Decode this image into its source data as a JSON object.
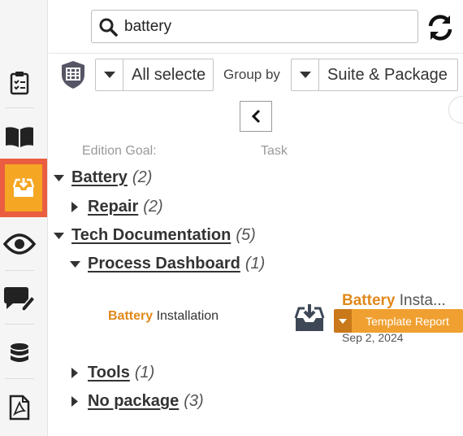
{
  "search": {
    "value": "battery"
  },
  "filters": {
    "edition_value": "All selecte",
    "groupby_label": "Group by",
    "groupby_value": "Suite & Package"
  },
  "columns": {
    "edition_goal": "Edition Goal:",
    "task": "Task"
  },
  "tree": {
    "battery": {
      "name": "Battery",
      "count": "(2)"
    },
    "repair": {
      "name": "Repair",
      "count": "(2)"
    },
    "techdoc": {
      "name": "Tech Documentation",
      "count": "(5)"
    },
    "process": {
      "name": "Process Dashboard",
      "count": "(1)"
    },
    "tools": {
      "name": "Tools",
      "count": "(1)"
    },
    "nopackage": {
      "name": "No package",
      "count": "(3)"
    }
  },
  "task": {
    "highlight": "Battery",
    "rest": " Installation",
    "card_highlight": "Battery",
    "card_rest": " Insta...",
    "template_label": "Template Report",
    "date": "Sep 2, 2024"
  },
  "colors": {
    "accent": "#f0a030",
    "active_border": "#ea5d40",
    "highlight": "#e0891a"
  }
}
